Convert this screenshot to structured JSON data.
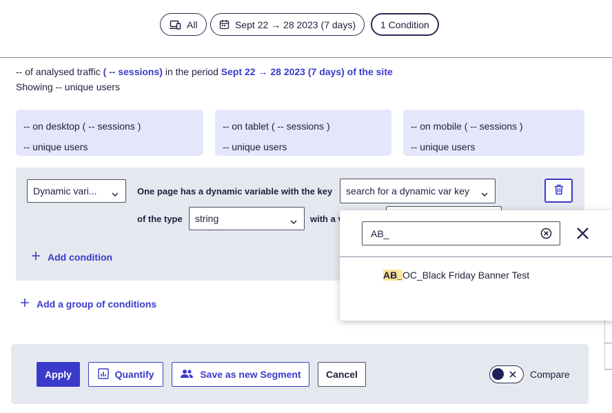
{
  "filters": {
    "device_label": "All",
    "period_label": "Sept 22 → 28 2023 (7 days)",
    "condition_label": "1 Condition"
  },
  "summary": {
    "line1_prefix": "-- of analysed traffic ",
    "line1_sessions": "( -- sessions)",
    "line1_mid": " in the period ",
    "line1_period": "Sept 22 → 28 2023 (7 days) of the site",
    "line2": "Showing -- unique users"
  },
  "stats": [
    {
      "line1": "-- on desktop ( -- sessions )",
      "line2": "-- unique users"
    },
    {
      "line1": "-- on tablet ( -- sessions )",
      "line2": "-- unique users"
    },
    {
      "line1": "-- on mobile ( -- sessions )",
      "line2": "-- unique users"
    }
  ],
  "condition": {
    "type_select": "Dynamic vari...",
    "key_text": "One page has a dynamic variable with the key",
    "key_select": "search for a dynamic var key",
    "of_type_text": "of the type",
    "type_value": "string",
    "with_value_text": "with a v",
    "add_condition": "Add condition"
  },
  "add_group": "Add a group of conditions",
  "popup": {
    "search_value": "AB_",
    "result_match": "AB_",
    "result_rest": "OC_Black Friday Banner Test"
  },
  "footer": {
    "apply": "Apply",
    "quantify": "Quantify",
    "save_segment": "Save as new Segment",
    "cancel": "Cancel",
    "compare": "Compare"
  },
  "colors": {
    "accent": "#3a3acb",
    "stat_bg": "#e4e6fb",
    "panel_bg": "#e6e8f0",
    "highlight": "#fbe39a"
  },
  "icons": [
    "devices-icon",
    "calendar-icon",
    "chevron-down-icon",
    "trash-icon",
    "plus-icon",
    "clear-circle-icon",
    "close-icon",
    "chart-icon",
    "users-icon",
    "x-icon"
  ]
}
